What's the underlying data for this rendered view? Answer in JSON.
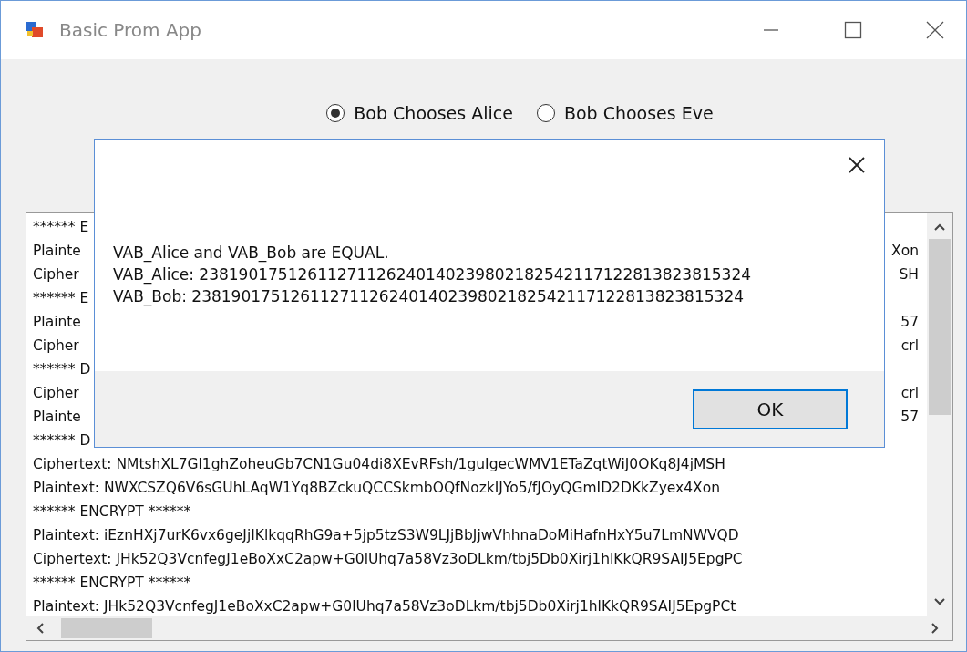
{
  "window": {
    "title": "Basic Prom App"
  },
  "options": [
    {
      "label": "Bob Chooses Alice",
      "selected": true
    },
    {
      "label": "Bob Chooses Eve",
      "selected": false
    }
  ],
  "log": {
    "lines": [
      {
        "text": "****** E"
      },
      {
        "text": "Plainte",
        "end": "Xon"
      },
      {
        "text": "Cipher",
        "end": "SH"
      },
      {
        "text": "****** E"
      },
      {
        "text": "Plainte",
        "end": "57"
      },
      {
        "text": "Cipher",
        "end": "crl"
      },
      {
        "text": "****** D"
      },
      {
        "text": "Cipher",
        "end": "crl"
      },
      {
        "text": "Plainte",
        "end": "57"
      },
      {
        "text": "****** D"
      },
      {
        "text": "Ciphertext: NMtshXL7Gl1ghZoheuGb7CN1Gu04di8XEvRFsh/1guIgecWMV1ETaZqtWiJ0OKq8J4jMSH"
      },
      {
        "text": "Plaintext:  NWXCSZQ6V6sGUhLAqW1Yq8BZckuQCCSkmbOQfNozkIJYo5/fJOyQGmID2DKkZyex4Xon"
      },
      {
        "text": "****** ENCRYPT ******"
      },
      {
        "text": "Plaintext:  iEznHXj7urK6vx6geJjIKlkqqRhG9a+5jp5tzS3W9LJjBbJjwVhhnaDoMiHafnHxY5u7LmNWVQD"
      },
      {
        "text": "Ciphertext: JHk52Q3VcnfegJ1eBoXxC2apw+G0lUhq7a58Vz3oDLkm/tbj5Db0Xirj1hlKkQR9SAIJ5EpgPC"
      },
      {
        "text": "****** ENCRYPT ******"
      },
      {
        "text": "Plaintext:  JHk52Q3VcnfegJ1eBoXxC2apw+G0lUhq7a58Vz3oDLkm/tbj5Db0Xirj1hlKkQR9SAIJ5EpgPCt"
      }
    ]
  },
  "dialog": {
    "message": [
      "VAB_Alice and VAB_Bob are EQUAL.",
      "VAB_Alice: 23819017512611271126240140239802182542117122813823815324",
      "VAB_Bob: 23819017512611271126240140239802182542117122813823815324"
    ],
    "button": "OK"
  }
}
